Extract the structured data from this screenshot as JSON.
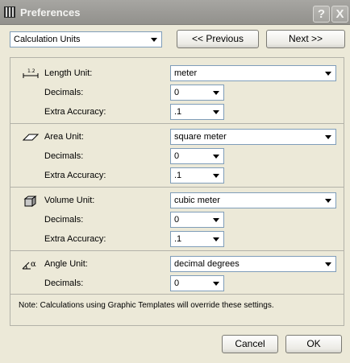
{
  "window": {
    "title": "Preferences",
    "help_label": "?",
    "close_label": "X"
  },
  "nav": {
    "category_value": "Calculation Units",
    "previous_label": "<< Previous",
    "next_label": "Next >>"
  },
  "length": {
    "label": "Length Unit:",
    "value": "meter",
    "decimals_label": "Decimals:",
    "decimals_value": "0",
    "accuracy_label": "Extra Accuracy:",
    "accuracy_value": ".1"
  },
  "area": {
    "label": "Area Unit:",
    "value": "square meter",
    "decimals_label": "Decimals:",
    "decimals_value": "0",
    "accuracy_label": "Extra Accuracy:",
    "accuracy_value": ".1"
  },
  "volume": {
    "label": "Volume Unit:",
    "value": "cubic meter",
    "decimals_label": "Decimals:",
    "decimals_value": "0",
    "accuracy_label": "Extra Accuracy:",
    "accuracy_value": ".1"
  },
  "angle": {
    "label": "Angle Unit:",
    "value": "decimal degrees",
    "decimals_label": "Decimals:",
    "decimals_value": "0"
  },
  "note": "Note:   Calculations using Graphic Templates will override these settings.",
  "footer": {
    "cancel_label": "Cancel",
    "ok_label": "OK"
  },
  "icons": {
    "app": "ruler-app-icon",
    "length": "length-dimension-icon",
    "area": "area-plane-icon",
    "volume": "volume-cube-icon",
    "angle": "angle-alpha-icon"
  },
  "colors": {
    "titlebar": "#9c9b97",
    "dialog_bg": "#ece9d8",
    "field_border": "#7f9db9"
  }
}
